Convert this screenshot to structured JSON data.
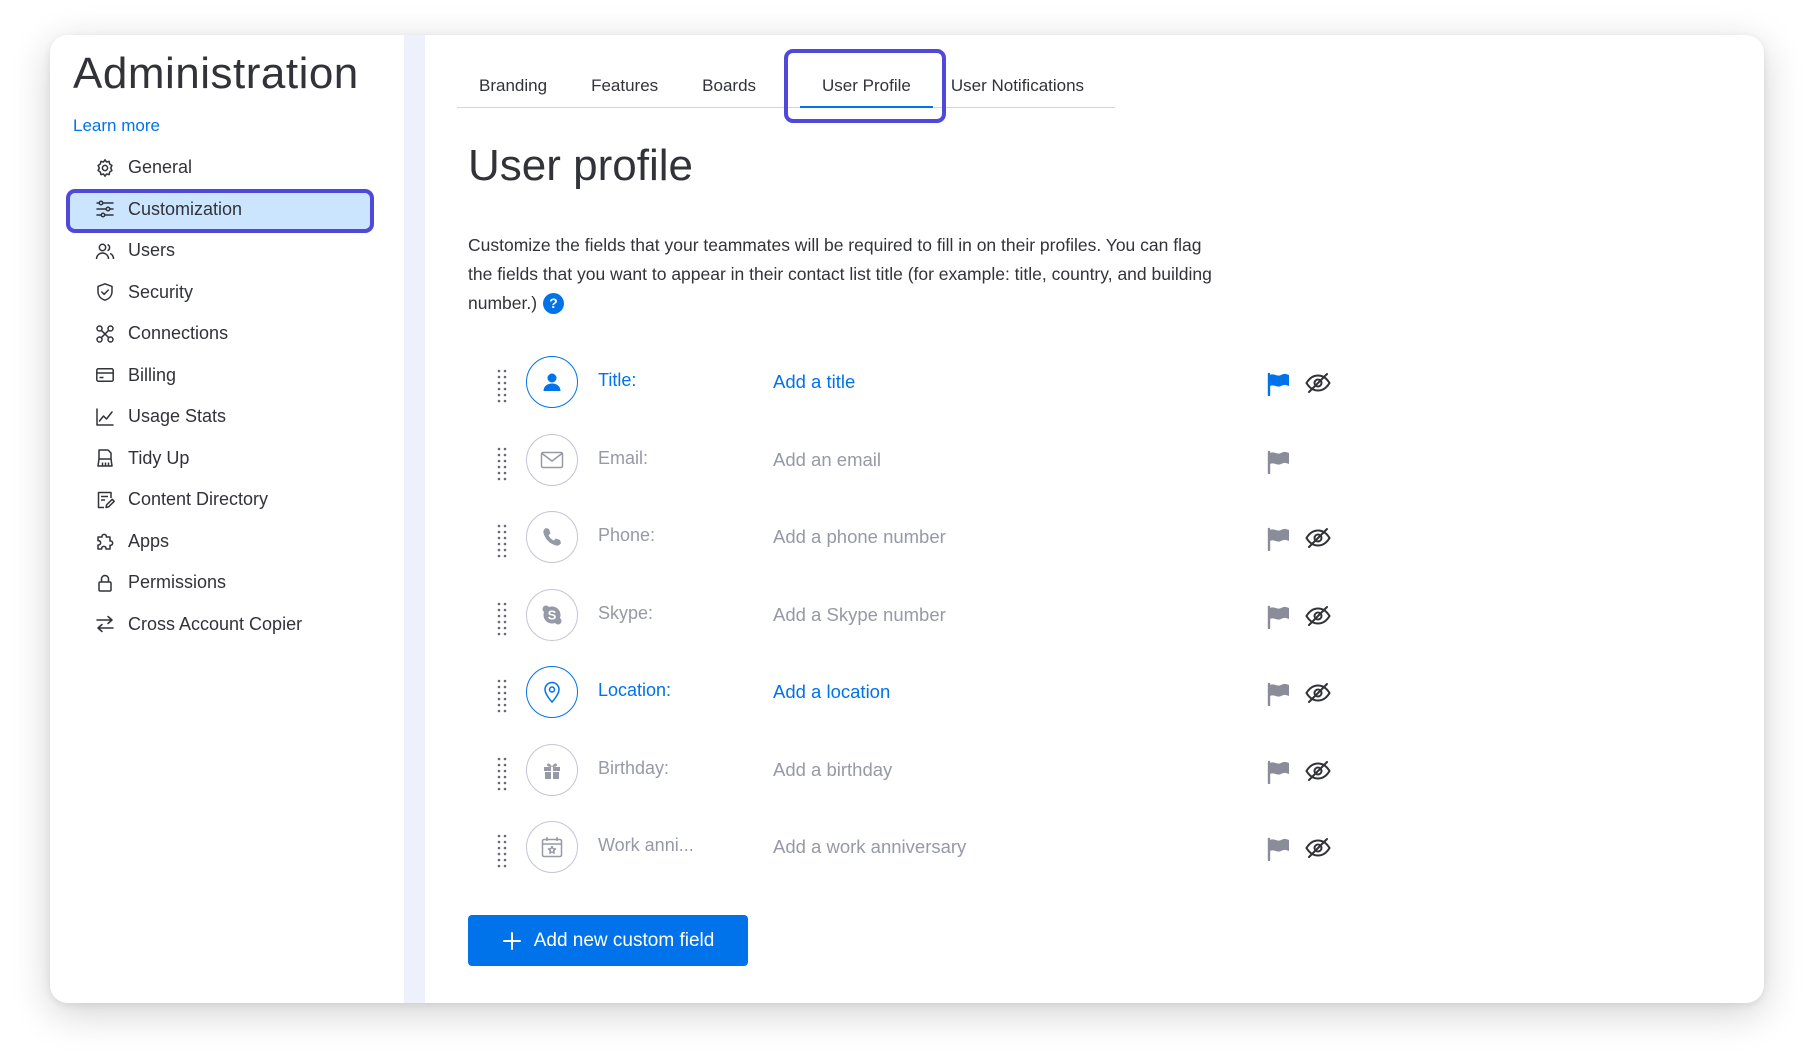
{
  "sidebar": {
    "title": "Administration",
    "learn_more": "Learn more",
    "items": [
      {
        "label": "General",
        "icon": "gear-icon"
      },
      {
        "label": "Customization",
        "icon": "sliders-icon",
        "active": true
      },
      {
        "label": "Users",
        "icon": "users-icon"
      },
      {
        "label": "Security",
        "icon": "shield-icon"
      },
      {
        "label": "Connections",
        "icon": "connections-icon"
      },
      {
        "label": "Billing",
        "icon": "credit-card-icon"
      },
      {
        "label": "Usage Stats",
        "icon": "line-chart-icon"
      },
      {
        "label": "Tidy Up",
        "icon": "broom-icon"
      },
      {
        "label": "Content Directory",
        "icon": "content-directory-icon"
      },
      {
        "label": "Apps",
        "icon": "puzzle-icon"
      },
      {
        "label": "Permissions",
        "icon": "lock-icon"
      },
      {
        "label": "Cross Account Copier",
        "icon": "swap-arrows-icon"
      }
    ]
  },
  "tabs": [
    {
      "label": "Branding"
    },
    {
      "label": "Features"
    },
    {
      "label": "Boards"
    },
    {
      "label": "User Profile",
      "active": true
    },
    {
      "label": "User Notifications"
    }
  ],
  "page": {
    "title": "User profile",
    "description": "Customize the fields that your teammates will be required to fill in on their profiles. You can flag the fields that you want to appear in their contact list title (for example: title, country, and building number.)",
    "help": "?"
  },
  "fields": [
    {
      "label": "Title:",
      "value": "Add a title",
      "icon": "user-icon",
      "highlight": true,
      "flagged": true,
      "has_visibility": true
    },
    {
      "label": "Email:",
      "value": "Add an email",
      "icon": "envelope-icon",
      "highlight": false,
      "flagged": false,
      "has_visibility": false
    },
    {
      "label": "Phone:",
      "value": "Add a phone number",
      "icon": "phone-icon",
      "highlight": false,
      "flagged": false,
      "has_visibility": true
    },
    {
      "label": "Skype:",
      "value": "Add a Skype number",
      "icon": "skype-icon",
      "highlight": false,
      "flagged": false,
      "has_visibility": true
    },
    {
      "label": "Location:",
      "value": "Add a location",
      "icon": "location-pin-icon",
      "highlight": true,
      "flagged": false,
      "has_visibility": true
    },
    {
      "label": "Birthday:",
      "value": "Add a birthday",
      "icon": "gift-icon",
      "highlight": false,
      "flagged": false,
      "has_visibility": true
    },
    {
      "label": "Work anni...",
      "value": "Add a work anniversary",
      "icon": "calendar-star-icon",
      "highlight": false,
      "flagged": false,
      "has_visibility": true
    }
  ],
  "add_button": {
    "label": "Add new custom field",
    "icon": "plus-icon"
  },
  "colors": {
    "accent": "#0073ea",
    "highlight_border": "#5048d9",
    "active_nav_bg": "#cce5ff",
    "divider": "#eef1fb",
    "muted_text": "#9699a6",
    "flag_muted": "#8a8d99"
  }
}
